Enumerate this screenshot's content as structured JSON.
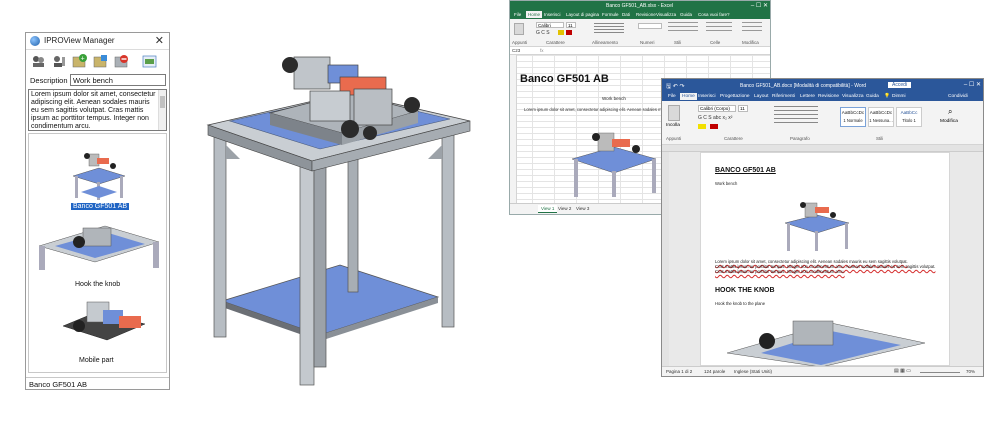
{
  "manager": {
    "title": "IPROView Manager",
    "description_label": "Description",
    "description_value": "Work bench",
    "notes": "Lorem ipsum dolor sit amet, consectetur adipiscing elit. Aenean sodales mauris eu sem sagittis volutpat. Cras mattis ipsum ac porttitor tempus. Integer non condimentum arcu.",
    "items": [
      {
        "label": "Banco GF501 AB",
        "selected": true
      },
      {
        "label": "Hook the knob",
        "selected": false
      },
      {
        "label": "Mobile part",
        "selected": false
      }
    ],
    "status": "Banco GF501 AB",
    "tool_icons": [
      "people-icon",
      "person-list-icon",
      "add-view-icon",
      "edit-view-icon",
      "delete-view-icon",
      "export-icon"
    ]
  },
  "excel": {
    "title": "Banco GF501_AB.xlsx - Excel",
    "tabs": [
      "File",
      "Home",
      "Inserisci",
      "Layout di pagina",
      "Formule",
      "Dati",
      "Revisione",
      "Visualizza",
      "Guida",
      "Cosa vuoi fare?"
    ],
    "font_name": "Calibri",
    "font_size": "11",
    "groups": [
      "Appunti",
      "Carattere",
      "Allineamento",
      "Numeri",
      "Stili",
      "Celle",
      "Modifica"
    ],
    "cell_ref": "C23",
    "heading": "Banco GF501 AB",
    "subheading": "Work bench",
    "body": "Lorem ipsum dolor sit amet, consectetur adipiscing elit. Aenean sodales mauris eu sem sagittis volutpat.",
    "sheets": [
      "View 1",
      "View 2",
      "View 3"
    ],
    "accent": "#217346"
  },
  "word": {
    "title": "Banco GF501_AB.docx [Modalità di compatibilità] - Word",
    "account_button": "Accedi",
    "tabs": [
      "File",
      "Home",
      "Inserisci",
      "Progettazione",
      "Layout",
      "Riferimenti",
      "Lettere",
      "Revisione",
      "Visualizza",
      "Guida",
      "Dimmi",
      "Condividi"
    ],
    "paste": "Incolla",
    "font_name": "Calibri (Corpo)",
    "font_size": "11",
    "styles": [
      "AaBbCcDc",
      "AaBbCcDc",
      "AaBbCc"
    ],
    "style_names": [
      "1 Normale",
      "1 Nessuna...",
      "Titolo 1"
    ],
    "edit": "Modifica",
    "groups": [
      "Appunti",
      "Carattere",
      "Paragrafo",
      "Stili"
    ],
    "heading1": "BANCO GF501 AB",
    "sub1": "Work bench",
    "para1_lines": [
      "Lorem ipsum dolor sit amet, consectetur adipiscing elit. Aenean sodales mauris eu sem sagittis volutpat.",
      "Cras mattis ipsum ac porttitor tempus. Integer non condimentum arcu. Aenean sodales mauris eu sem sagittis volutpat.",
      "Cras mattis ipsum ac porttitor tempus. Integer non condimentum arcu."
    ],
    "heading2": "HOOK THE KNOB",
    "sub2": "Hook the knob to the plane",
    "status_page": "Pagina 1 di 2",
    "status_words": "124 parole",
    "status_lang": "Inglese (Stati Uniti)",
    "zoom": "70%",
    "accent": "#2b579a"
  }
}
